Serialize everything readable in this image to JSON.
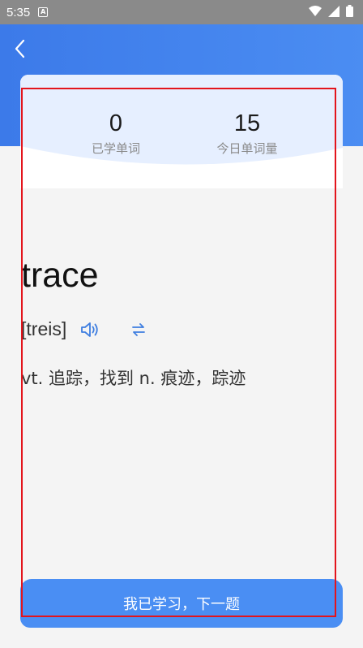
{
  "status_bar": {
    "time": "5:35",
    "app_icon_letter": "A",
    "icons": [
      "wifi-icon",
      "signal-icon",
      "battery-icon"
    ]
  },
  "header": {
    "back_icon": "chevron-left-icon"
  },
  "stats": {
    "learned_value": "0",
    "learned_label": "已学单词",
    "today_value": "15",
    "today_label": "今日单词量"
  },
  "word_card": {
    "word": "trace",
    "phonetic": "[treis]",
    "speaker_icon": "speaker-icon",
    "swap_icon": "swap-icon",
    "definition": "vt. 追踪，找到 n. 痕迹，踪迹"
  },
  "actions": {
    "next_label": "我已学习，下一题"
  },
  "colors": {
    "accent": "#4a8ef3",
    "header_blue": "#3c7ae9",
    "highlight_red": "#e3141c",
    "icon_blue": "#3d7de0"
  }
}
